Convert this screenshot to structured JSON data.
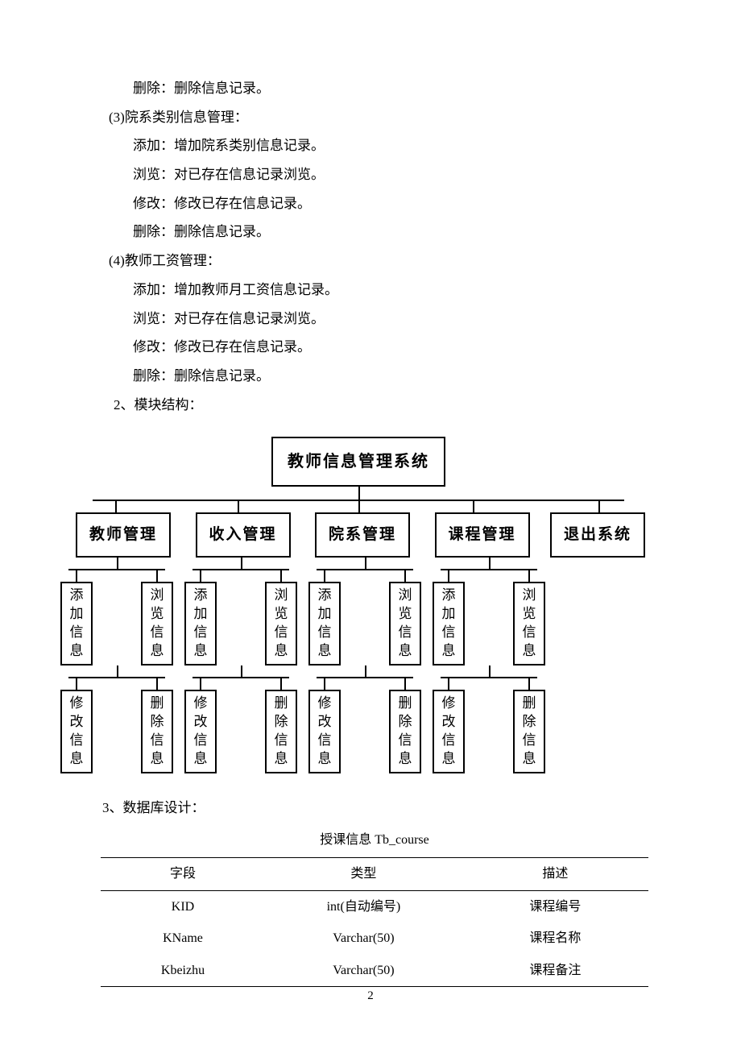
{
  "lines": {
    "l1": "删除：删除信息记录。",
    "s3": "(3)院系类别信息管理：",
    "s3a": "添加：增加院系类别信息记录。",
    "s3b": "浏览：对已存在信息记录浏览。",
    "s3c": "修改：修改已存在信息记录。",
    "s3d": "删除：删除信息记录。",
    "s4": "(4)教师工资管理：",
    "s4a": "添加：增加教师月工资信息记录。",
    "s4b": "浏览：对已存在信息记录浏览。",
    "s4c": "修改：修改已存在信息记录。",
    "s4d": "删除：删除信息记录。",
    "h2": "2、模块结构：",
    "h3": "3、数据库设计："
  },
  "diagram": {
    "root": "教师信息管理系统",
    "modules": [
      "教师管理",
      "收入管理",
      "院系管理",
      "课程管理",
      "退出系统"
    ],
    "ops_top": [
      "添加信息",
      "浏览信息"
    ],
    "ops_bot": [
      "修改信息",
      "删除信息"
    ]
  },
  "table": {
    "title": "授课信息 Tb_course",
    "headers": [
      "字段",
      "类型",
      "描述"
    ],
    "rows": [
      [
        "KID",
        "int(自动编号)",
        "课程编号"
      ],
      [
        "KName",
        "Varchar(50)",
        "课程名称"
      ],
      [
        "Kbeizhu",
        "Varchar(50)",
        "课程备注"
      ]
    ]
  },
  "page": "2"
}
